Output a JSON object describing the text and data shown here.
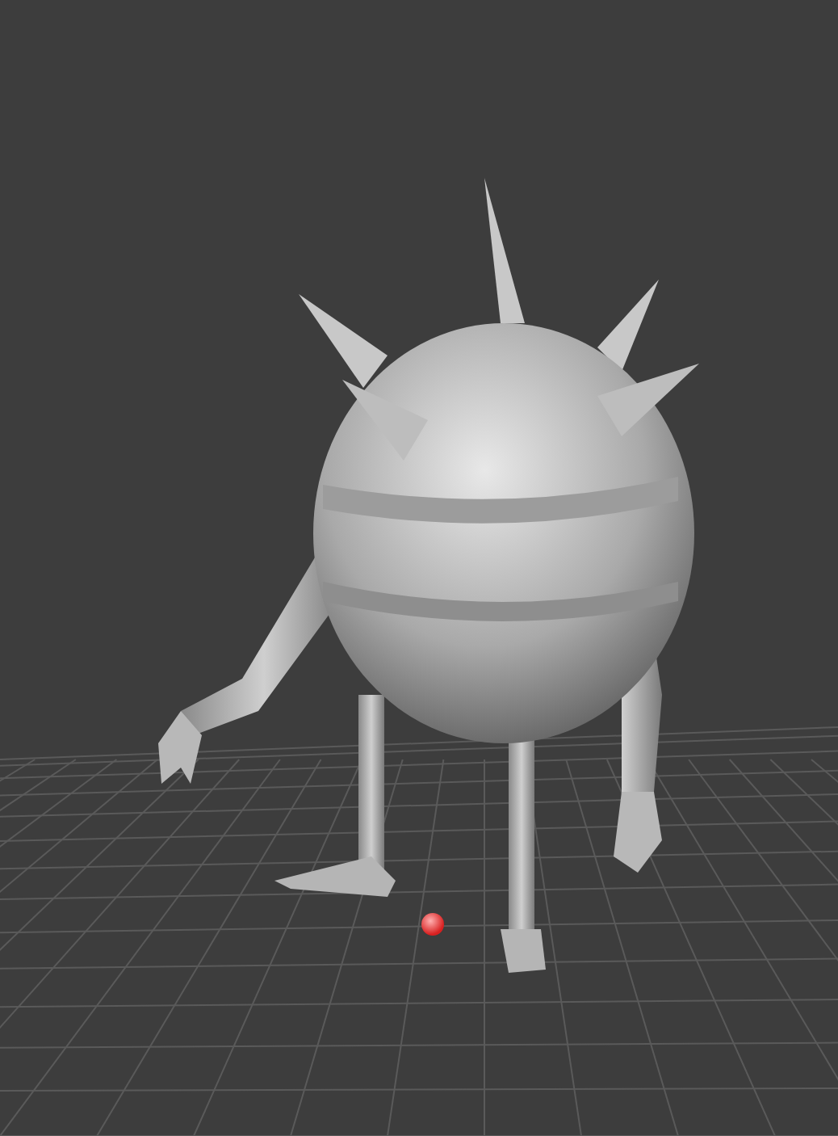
{
  "viewport": {
    "grid": true,
    "marker": true
  }
}
